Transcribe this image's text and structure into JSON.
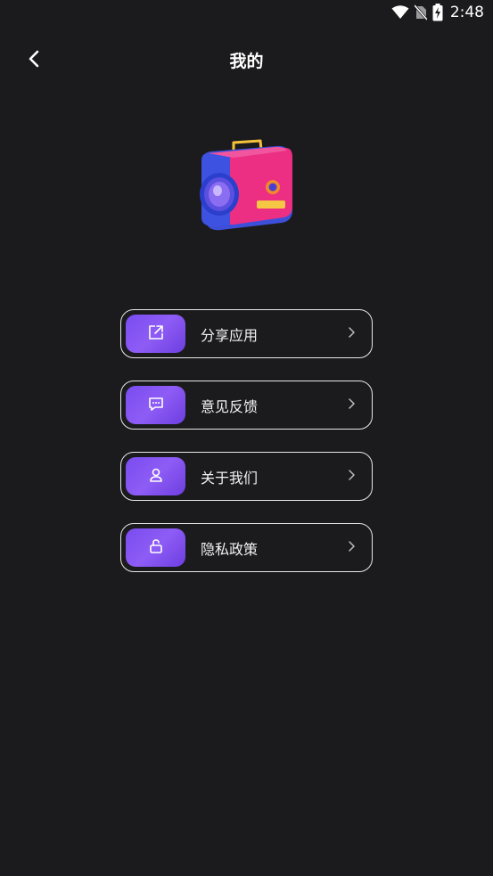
{
  "status_bar": {
    "time": "2:48"
  },
  "header": {
    "title": "我的"
  },
  "menu": {
    "items": [
      {
        "label": "分享应用",
        "icon": "share-icon"
      },
      {
        "label": "意见反馈",
        "icon": "feedback-icon"
      },
      {
        "label": "关于我们",
        "icon": "user-icon"
      },
      {
        "label": "隐私政策",
        "icon": "lock-icon"
      }
    ]
  },
  "colors": {
    "background": "#1b1b1d",
    "accent": "#7a4cf0",
    "border": "#e8e8e8"
  }
}
